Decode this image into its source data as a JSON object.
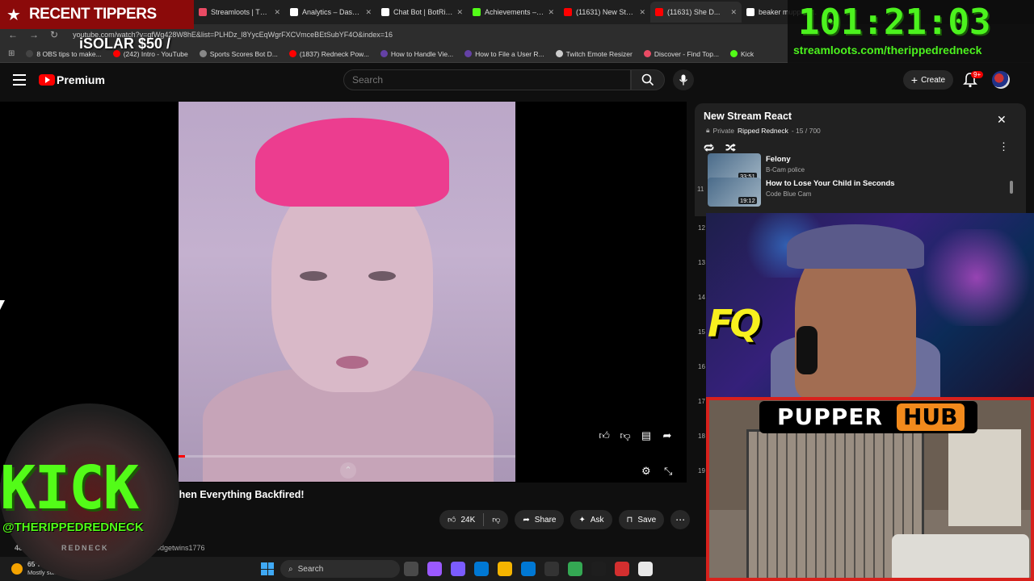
{
  "browser": {
    "tabs": [
      {
        "title": "Streamloots | The...",
        "color": "#e94b64",
        "active": false
      },
      {
        "title": "Analytics – Dashb...",
        "color": "#ffffff",
        "active": false
      },
      {
        "title": "Chat Bot | BotRix...",
        "color": "#ffffff",
        "active": false
      },
      {
        "title": "Achievements – Ki...",
        "color": "#53fc18",
        "active": false
      },
      {
        "title": "(11631) New Stre...",
        "color": "#ff0000",
        "active": false
      },
      {
        "title": "(11631) She D...",
        "color": "#ff0000",
        "active": true
      },
      {
        "title": "beaker muppets...",
        "color": "#ffffff",
        "active": false
      }
    ],
    "url": "youtube.com/watch?v=qfWg428W8hE&list=PLHDz_l8YycEqWgrFXCVmceBEtSubYF4O&index=16",
    "bookmarks": [
      {
        "label": "8 OBS tips to make...",
        "color": "#444444"
      },
      {
        "label": "(242) Intro - YouTube",
        "color": "#ff0000"
      },
      {
        "label": "Sports Scores Bot D...",
        "color": "#888888"
      },
      {
        "label": "(1837) Redneck Pow...",
        "color": "#ff0000"
      },
      {
        "label": "How to Handle Vie...",
        "color": "#6441a5"
      },
      {
        "label": "How to File a User R...",
        "color": "#6441a5"
      },
      {
        "label": "Twitch Emote Resizer",
        "color": "#cccccc"
      },
      {
        "label": "Discover - Find Top...",
        "color": "#e94b64"
      },
      {
        "label": "Kick",
        "color": "#53fc18"
      }
    ]
  },
  "overlay": {
    "recent_tippers": "RECENT TIPPERS",
    "tip_line": "iSOLAR $50 /",
    "timer": "101:21:03",
    "timer_url": "streamloots.com/therippedredneck",
    "kick_word": "KICK",
    "kick_handle": "@THERIPPEDREDNECK",
    "kick_sub": "REDNECK",
    "pupper_word": "PUPPER",
    "pupper_hub": "HUB",
    "webcam_logo": "FQ"
  },
  "youtube": {
    "brand": "Premium",
    "search_placeholder": "Search",
    "create_label": "Create",
    "notif_count": "9+",
    "video_title": "Then Everything Backfired!",
    "likes": "24K",
    "share_label": "Share",
    "ask_label": "Ask",
    "save_label": "Save",
    "channel": "nodgetwins1776",
    "views": "485",
    "progress": 0.02
  },
  "playlist": {
    "title": "New Stream React",
    "privacy": "Private",
    "owner": "Ripped Redneck",
    "position": "- 15 / 700",
    "items": [
      {
        "index": "",
        "title": "Felony",
        "channel": "B-Cam police",
        "duration": "33:51"
      },
      {
        "index": "11",
        "title": "How to Lose Your Child in Seconds",
        "channel": "Code Blue Cam",
        "duration": "19:12"
      }
    ],
    "hidden_numbers": [
      "12",
      "13",
      "14",
      "15",
      "16",
      "17",
      "18",
      "19"
    ]
  },
  "taskbar": {
    "temperature": "65°F",
    "condition": "Mostly sunny",
    "search_label": "Search",
    "app_colors": [
      "#4a4a4a",
      "#9b59ff",
      "#7b5cff",
      "#0078d4",
      "#f5b400",
      "#0078d4",
      "#333333",
      "#34a853",
      "#1e1e1e",
      "#d32f2f",
      "#e8e8e8"
    ]
  }
}
